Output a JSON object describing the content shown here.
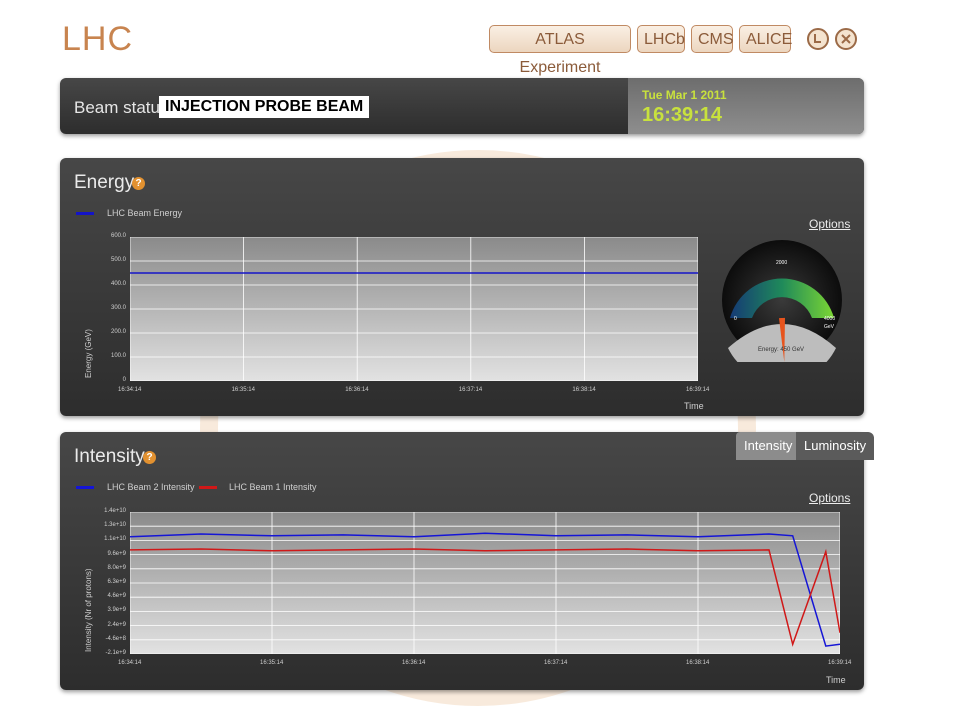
{
  "header": {
    "logo": "LHC",
    "nav": [
      "ATLAS Experiment",
      "LHCb",
      "CMS",
      "ALICE"
    ]
  },
  "beam": {
    "label": "Beam status:",
    "value": "INJECTION PROBE BEAM",
    "date": "Tue Mar 1 2011",
    "time": "16:39:14"
  },
  "energy": {
    "title": "Energy",
    "help": "?",
    "options": "Options",
    "gauge_label": "Energy: 450 GeV",
    "gauge_ticks": {
      "min": "0",
      "mid": "2000",
      "max": "4000",
      "unit": "GeV"
    },
    "gauge_value": 450,
    "gauge_max": 4000
  },
  "intensity": {
    "title": "Intensity",
    "help": "?",
    "options": "Options",
    "tabs": [
      "Intensity",
      "Luminosity"
    ]
  },
  "colors": {
    "beam2": "#1515d6",
    "beam1": "#d01818",
    "energy": "#1414c8",
    "accent": "#c8844f"
  },
  "chart_data": [
    {
      "type": "line",
      "title": "",
      "xlabel": "Time",
      "ylabel": "Energy (GeV)",
      "x_ticks": [
        "16:34:14",
        "16:35:14",
        "16:36:14",
        "16:37:14",
        "16:38:14",
        "16:39:14"
      ],
      "y_ticks": [
        "0",
        "100.0",
        "200.0",
        "300.0",
        "400.0",
        "500.0",
        "600.0"
      ],
      "ylim": [
        0,
        600
      ],
      "series": [
        {
          "name": "LHC Beam Energy",
          "x": [
            "16:34:14",
            "16:39:14"
          ],
          "values": [
            450,
            450
          ]
        }
      ]
    },
    {
      "type": "line",
      "title": "",
      "xlabel": "Time",
      "ylabel": "Intensity (Nr of protons)",
      "x_ticks": [
        "16:34:14",
        "16:35:14",
        "16:36:14",
        "16:37:14",
        "16:38:14",
        "16:39:14"
      ],
      "y_ticks": [
        "-2.1e+9",
        "-4.6e+8",
        "2.4e+9",
        "3.9e+9",
        "4.6e+9",
        "6.3e+9",
        "8.0e+9",
        "9.6e+9",
        "1.1e+10",
        "1.3e+10",
        "1.4e+10"
      ],
      "ylim": [
        -2100000000,
        14000000000
      ],
      "series": [
        {
          "name": "LHC Beam 2 Intensity",
          "x": [
            "16:34:14",
            "16:34:44",
            "16:35:14",
            "16:35:44",
            "16:36:14",
            "16:36:44",
            "16:37:14",
            "16:37:44",
            "16:38:14",
            "16:38:44",
            "16:38:54",
            "16:39:08",
            "16:39:14"
          ],
          "values": [
            11200000000,
            11500000000,
            11300000000,
            11400000000,
            11200000000,
            11600000000,
            11300000000,
            11400000000,
            11200000000,
            11500000000,
            11300000000,
            -1200000000,
            -1000000000
          ]
        },
        {
          "name": "LHC Beam 1 Intensity",
          "x": [
            "16:34:14",
            "16:34:44",
            "16:35:14",
            "16:35:44",
            "16:36:14",
            "16:36:44",
            "16:37:14",
            "16:37:44",
            "16:38:14",
            "16:38:44",
            "16:38:54",
            "16:39:08",
            "16:39:14"
          ],
          "values": [
            9700000000,
            9800000000,
            9600000000,
            9700000000,
            9800000000,
            9600000000,
            9700000000,
            9800000000,
            9600000000,
            9700000000,
            -1000000000,
            9500000000,
            300000000
          ]
        }
      ]
    }
  ]
}
